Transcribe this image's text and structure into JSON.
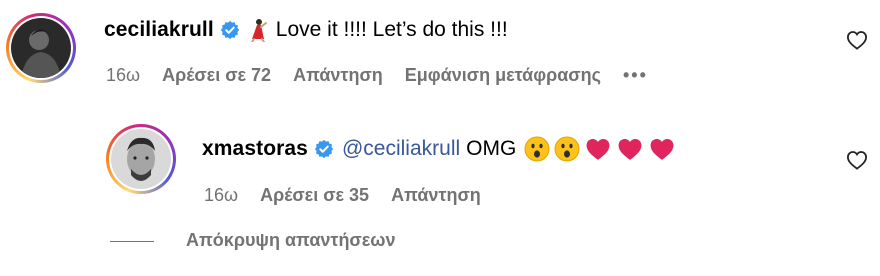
{
  "comment": {
    "username": "ceciliakrull",
    "text": "Love it !!!! Let’s do this !!!",
    "time": "16ω",
    "likes": "Αρέσει σε 72",
    "reply_label": "Απάντηση",
    "translate_label": "Εμφάνιση μετάφρασης",
    "more_label": "•••"
  },
  "reply": {
    "username": "xmastoras",
    "mention": "@ceciliakrull",
    "text": "OMG",
    "time": "16ω",
    "likes": "Αρέσει σε 35",
    "reply_label": "Απάντηση"
  },
  "hide_replies_label": "Απόκρυψη απαντήσεων",
  "colors": {
    "verified": "#3897f0",
    "meta": "#737373",
    "mention": "#385898",
    "heart_red": "#e0245e"
  }
}
